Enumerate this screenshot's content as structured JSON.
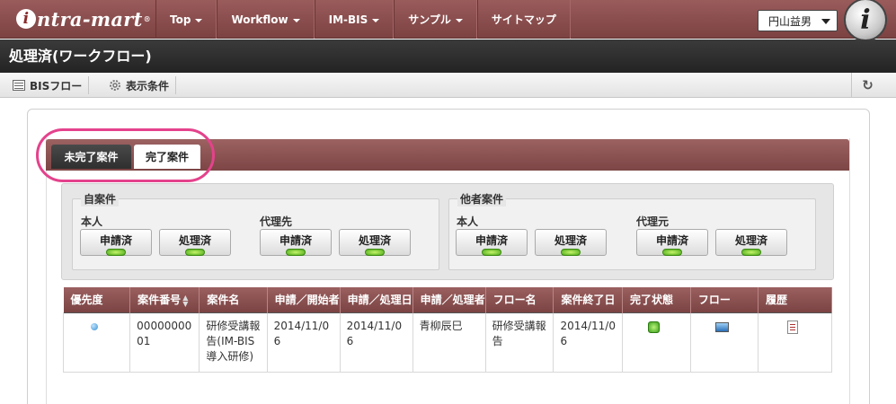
{
  "brand": {
    "logo_text": "ntra-mart",
    "logo_initial": "i",
    "logo_mark": "®",
    "icon_letter": "i"
  },
  "nav": {
    "items": [
      {
        "label": "Top",
        "has_menu": true
      },
      {
        "label": "Workflow",
        "has_menu": true
      },
      {
        "label": "IM-BIS",
        "has_menu": true
      },
      {
        "label": "サンプル",
        "has_menu": true
      },
      {
        "label": "サイトマップ",
        "has_menu": false
      }
    ]
  },
  "user": {
    "name": "円山益男"
  },
  "page": {
    "title": "処理済(ワークフロー)"
  },
  "toolbar": {
    "bis_flow_label": "BISフロー",
    "display_condition_label": "表示条件",
    "refresh_icon": "refresh-icon"
  },
  "tabs": {
    "incomplete_label": "未完了案件",
    "complete_label": "完了案件"
  },
  "filter": {
    "own": {
      "legend": "自案件",
      "self_label": "本人",
      "proxy_label": "代理先",
      "buttons": {
        "applied": "申請済",
        "processed": "処理済"
      }
    },
    "others": {
      "legend": "他者案件",
      "self_label": "本人",
      "proxy_label": "代理元",
      "buttons": {
        "applied": "申請済",
        "processed": "処理済"
      }
    }
  },
  "table": {
    "columns": [
      "優先度",
      "案件番号",
      "案件名",
      "申請／開始者",
      "申請／処理日",
      "申請／処理者",
      "フロー名",
      "案件終了日",
      "完了状態",
      "フロー",
      "履歴"
    ],
    "rows": [
      {
        "priority_icon": "blue-dot-icon",
        "case_number": "0000000001",
        "case_name": "研修受講報告(IM-BIS導入研修)",
        "start_date": "2014/11/06",
        "process_date": "2014/11/06",
        "processor": "青柳辰巳",
        "flow_name": "研修受講報告",
        "end_date": "2014/11/06",
        "status_icon": "complete-status-icon",
        "flow_icon": "flow-image-icon",
        "history_icon": "history-icon"
      }
    ]
  },
  "colors": {
    "accent": "#8a4f4f",
    "highlight": "#e4428c",
    "led": "#6cc92a"
  }
}
